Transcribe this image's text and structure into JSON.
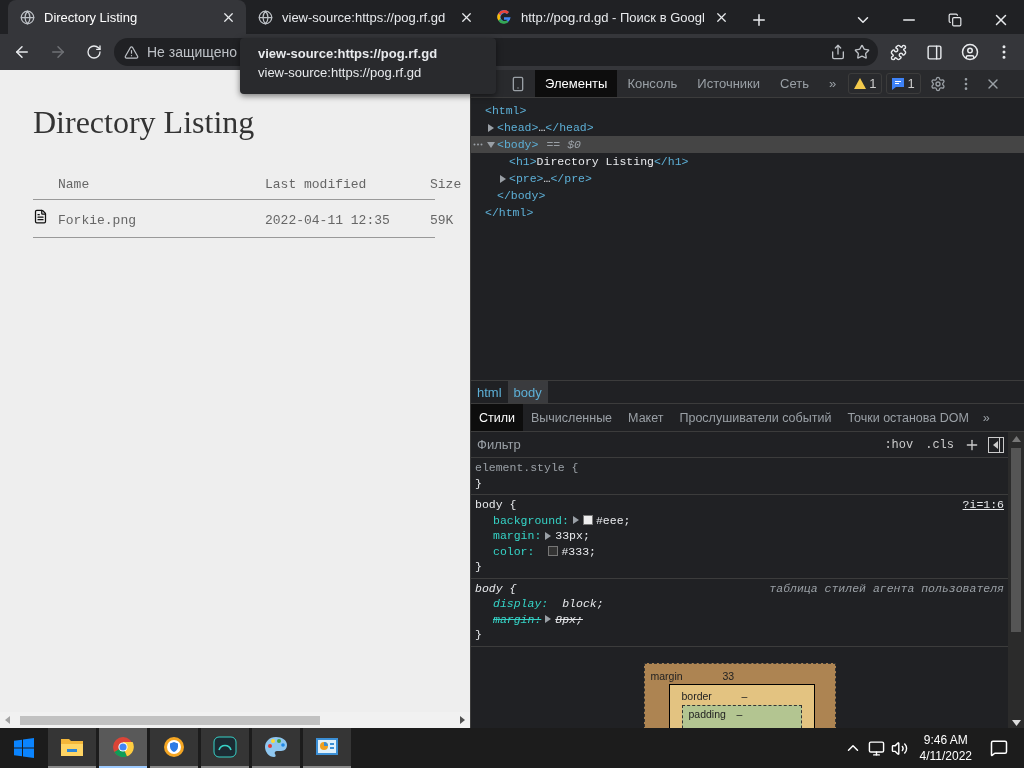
{
  "browser": {
    "tabs": [
      {
        "title": "Directory Listing",
        "kind": "globe",
        "selected": true
      },
      {
        "title": "view-source:https://pog.rf.gd",
        "kind": "globe",
        "selected": false
      },
      {
        "title": "http://pog.rd.gd - Поиск в Googl",
        "kind": "search_logo",
        "selected": false
      }
    ],
    "nav_buttons": [
      {
        "kind": "back",
        "disabled": false
      },
      {
        "kind": "forward",
        "disabled": true
      },
      {
        "kind": "reload",
        "disabled": false
      }
    ],
    "address": {
      "security": "Не защищено"
    },
    "tooltip": {
      "title": "view-source:https://pog.rf.gd",
      "url": "view-source:https://pog.rf.gd"
    }
  },
  "page": {
    "heading": "Directory Listing",
    "columns": [
      "Name",
      "Last modified",
      "Size"
    ],
    "rows": [
      {
        "kind": "file",
        "cells": [
          "Forkie.png",
          "2022-04-11 12:35",
          "59K"
        ]
      }
    ]
  },
  "devtools": {
    "tabs": [
      {
        "label": "Элементы",
        "selected": true
      },
      {
        "label": "Консоль",
        "selected": false
      },
      {
        "label": "Источники",
        "selected": false
      },
      {
        "label": "Сеть",
        "selected": false
      }
    ],
    "more": "»",
    "issues": [
      {
        "kind": "warning",
        "count": "1"
      },
      {
        "kind": "message",
        "count": "1"
      }
    ],
    "dom_tree": [
      {
        "open": "<html>",
        "close": "</html>",
        "expanded": true,
        "selected": false,
        "children": [
          {
            "open": "<head>",
            "ellipsis": "…",
            "close": "</head>",
            "expanded": false,
            "selected": false
          },
          {
            "open": "<body>",
            "close": "</body>",
            "marker": "== $0",
            "expanded": true,
            "selected": true,
            "children": [
              {
                "open": "<h1>",
                "text": "Directory Listing",
                "close": "</h1>",
                "selected": false
              },
              {
                "open": "<pre>",
                "ellipsis": "…",
                "close": "</pre>",
                "expanded": false,
                "selected": false
              }
            ]
          }
        ]
      }
    ],
    "breadcrumbs": [
      {
        "label": "html",
        "selected": false
      },
      {
        "label": "body",
        "selected": true
      }
    ],
    "style_tabs": [
      {
        "label": "Стили",
        "selected": true
      },
      {
        "label": "Вычисленные",
        "selected": false
      },
      {
        "label": "Макет",
        "selected": false
      },
      {
        "label": "Прослушиватели событий",
        "selected": false
      },
      {
        "label": "Точки останова DOM",
        "selected": false
      }
    ],
    "style_tabs_more": "»",
    "filter": {
      "placeholder": "Фильтр",
      "buttons": [
        ":hov",
        ".cls"
      ]
    },
    "rules": [
      {
        "kind": "inline",
        "selector": "element.style {",
        "close": "}"
      },
      {
        "kind": "author",
        "selector": "body {",
        "source": "?i=1:6",
        "close": "}",
        "declarations": [
          {
            "property": "background:",
            "value": "#eee;",
            "expandable": true,
            "color": "#eeeeee",
            "overridden": false
          },
          {
            "property": "margin:",
            "value": "33px;",
            "expandable": true,
            "overridden": false
          },
          {
            "property": "color:",
            "value": "#333;",
            "expandable": false,
            "color": "#333333",
            "overridden": false
          }
        ]
      },
      {
        "kind": "user_agent",
        "selector": "body {",
        "source": "таблица стилей агента пользователя",
        "close": "}",
        "declarations": [
          {
            "property": "display:",
            "value": "block;",
            "expandable": false,
            "overridden": false
          },
          {
            "property": "margin:",
            "value": "8px;",
            "expandable": true,
            "overridden": true
          }
        ]
      }
    ],
    "box_model": {
      "margin": {
        "label": "margin",
        "value": "33"
      },
      "border": {
        "label": "border",
        "value": "–"
      },
      "padding": {
        "label": "padding",
        "value": "–"
      }
    }
  },
  "taskbar": {
    "apps": [
      {
        "kind": "files",
        "selected": false
      },
      {
        "kind": "browser",
        "selected": true
      },
      {
        "kind": "shield_browser",
        "selected": false
      },
      {
        "kind": "emulator",
        "selected": false
      },
      {
        "kind": "paint",
        "selected": false
      },
      {
        "kind": "dashboard",
        "selected": false
      }
    ],
    "time": "9:46 AM",
    "date": "4/11/2022"
  }
}
